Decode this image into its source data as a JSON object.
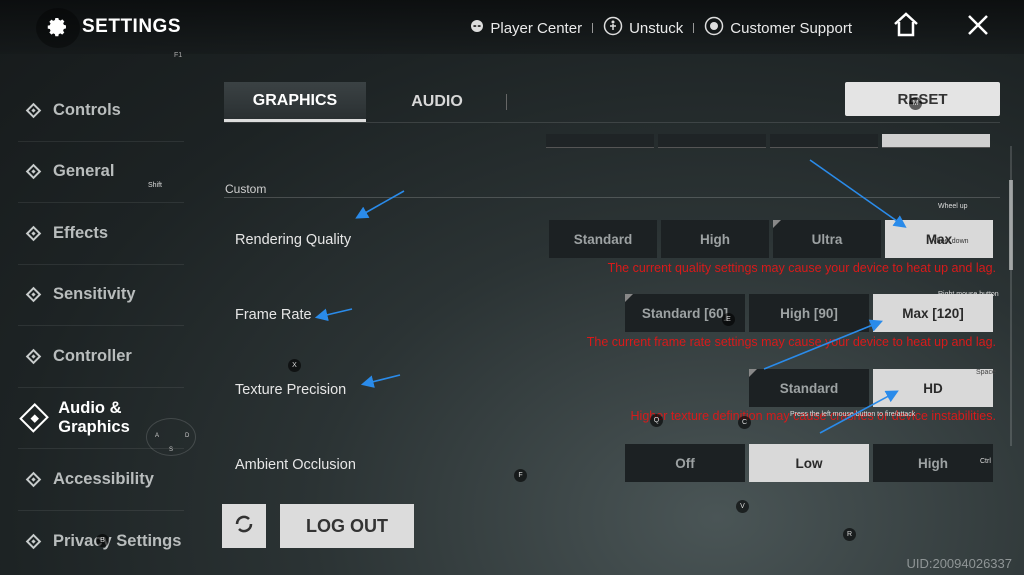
{
  "header": {
    "title": "SETTINGS",
    "f1_hint": "F1",
    "links": [
      {
        "label": "Player Center",
        "icon": "alien-head-icon"
      },
      {
        "label": "Unstuck",
        "icon": "unstuck-icon"
      },
      {
        "label": "Customer Support",
        "icon": "headset-icon"
      }
    ]
  },
  "sidebar": {
    "items": [
      {
        "label": "Controls"
      },
      {
        "label": "General"
      },
      {
        "label": "Effects"
      },
      {
        "label": "Sensitivity"
      },
      {
        "label": "Controller"
      },
      {
        "label": "Audio & Graphics"
      },
      {
        "label": "Accessibility"
      },
      {
        "label": "Privacy Settings"
      }
    ],
    "shift_hint": "Shift"
  },
  "tabs": [
    "GRAPHICS",
    "AUDIO"
  ],
  "reset_label": "RESET",
  "section_label": "Custom",
  "rows": {
    "rendering": {
      "label": "Rendering Quality",
      "options": [
        "Standard",
        "High",
        "Ultra",
        "Max"
      ],
      "warning": "The current quality settings may cause your device to heat up and lag."
    },
    "framerate": {
      "label": "Frame Rate",
      "options": [
        "Standard [60]",
        "High [90]",
        "Max [120]"
      ],
      "warning": "The current frame rate settings may cause your device to heat up and lag."
    },
    "texture": {
      "label": "Texture Precision",
      "options": [
        "Standard",
        "HD"
      ],
      "warning": "Higher texture definition may cause crashes or device instabilities."
    },
    "occlusion": {
      "label": "Ambient Occlusion",
      "options": [
        "Off",
        "Low",
        "High"
      ]
    }
  },
  "hints": {
    "wheel_up": "Wheel up",
    "wheel_down": "Wheel down",
    "right_mouse": "Right mouse button",
    "space": "Space",
    "left_mouse": "Press the left mouse button to fire/attack",
    "ctrl": "Ctrl",
    "keys": {
      "x": "X",
      "q": "Q",
      "c": "C",
      "e": "E",
      "f": "F",
      "v": "V",
      "r": "R",
      "b": "B",
      "a": "A",
      "d": "D",
      "s": "S",
      "m": "M"
    }
  },
  "logout_label": "LOG OUT",
  "uid": "UID:20094026337",
  "colors": {
    "warning": "#d81a1a",
    "selected_bg": "#d9d9d9",
    "arrow": "#2a8bea"
  }
}
